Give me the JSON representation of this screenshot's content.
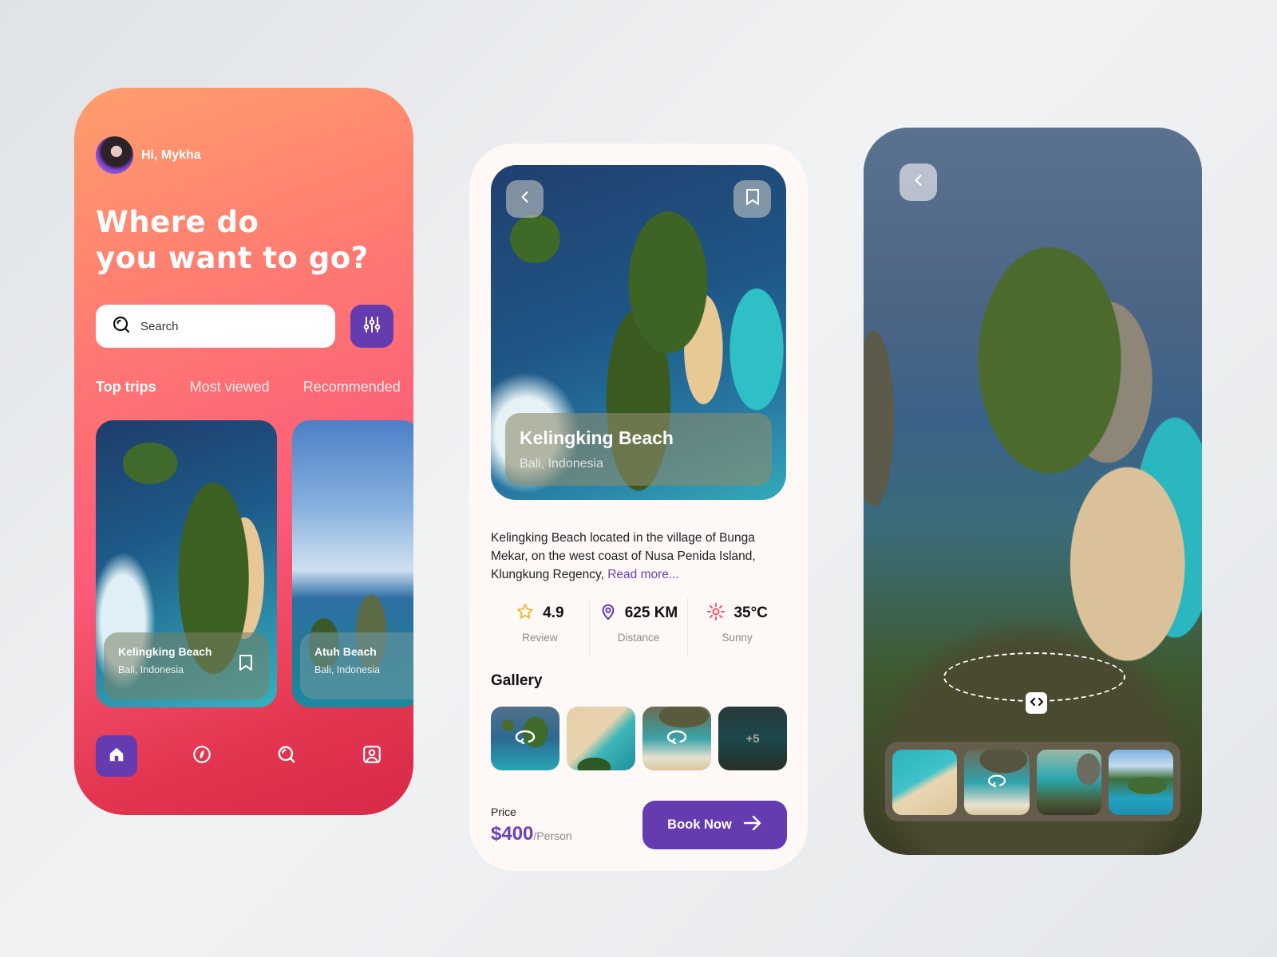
{
  "colors": {
    "accent": "#653cb0",
    "link": "#6a3fc0",
    "star": "#f0b840",
    "sun": "#f7546b",
    "gradient_start": "#ff9e6c",
    "gradient_end": "#d72a49"
  },
  "home": {
    "greeting": "Hi, Mykha",
    "headline_line1": "Where do",
    "headline_line2": "you want to go?",
    "search": {
      "placeholder": "Search",
      "icon": "search-icon"
    },
    "filter_icon": "sliders-icon",
    "tabs": [
      {
        "label": "Top trips",
        "active": true
      },
      {
        "label": "Most viewed",
        "active": false
      },
      {
        "label": "Recommended",
        "active": false
      }
    ],
    "trips": [
      {
        "title": "Kelingking Beach",
        "location": "Bali, Indonesia",
        "icon": "bookmark-icon"
      },
      {
        "title": "Atuh Beach",
        "location": "Bali, Indonesia"
      }
    ],
    "nav": [
      {
        "icon": "home-icon",
        "active": true
      },
      {
        "icon": "compass-icon",
        "active": false
      },
      {
        "icon": "search-icon",
        "active": false
      },
      {
        "icon": "profile-icon",
        "active": false
      }
    ]
  },
  "detail": {
    "back_icon": "chevron-left-icon",
    "bookmark_icon": "bookmark-icon",
    "title": "Kelingking Beach",
    "location": "Bali, Indonesia",
    "description": "Kelingking Beach located in the village of Bunga Mekar, on the west coast of Nusa Penida Island, Klungkung Regency, ",
    "read_more": "Read more...",
    "stats": [
      {
        "icon": "star-icon",
        "value": "4.9",
        "label": "Review"
      },
      {
        "icon": "location-pin-icon",
        "value": "625 KM",
        "label": "Distance"
      },
      {
        "icon": "sun-icon",
        "value": "35°C",
        "label": "Sunny"
      }
    ],
    "gallery_title": "Gallery",
    "gallery": [
      {
        "icon": "360-view-icon"
      },
      {},
      {
        "icon": "360-view-icon"
      },
      {
        "label": "+5"
      }
    ],
    "price_label": "Price",
    "price": "$400",
    "price_unit": "/Person",
    "book_button": "Book Now",
    "book_icon": "arrow-right-icon"
  },
  "viewer": {
    "back_icon": "chevron-left-icon",
    "ar_handle_icon": "code-arrows-icon",
    "thumbnails": [
      {},
      {
        "icon": "360-view-icon"
      },
      {},
      {}
    ]
  }
}
